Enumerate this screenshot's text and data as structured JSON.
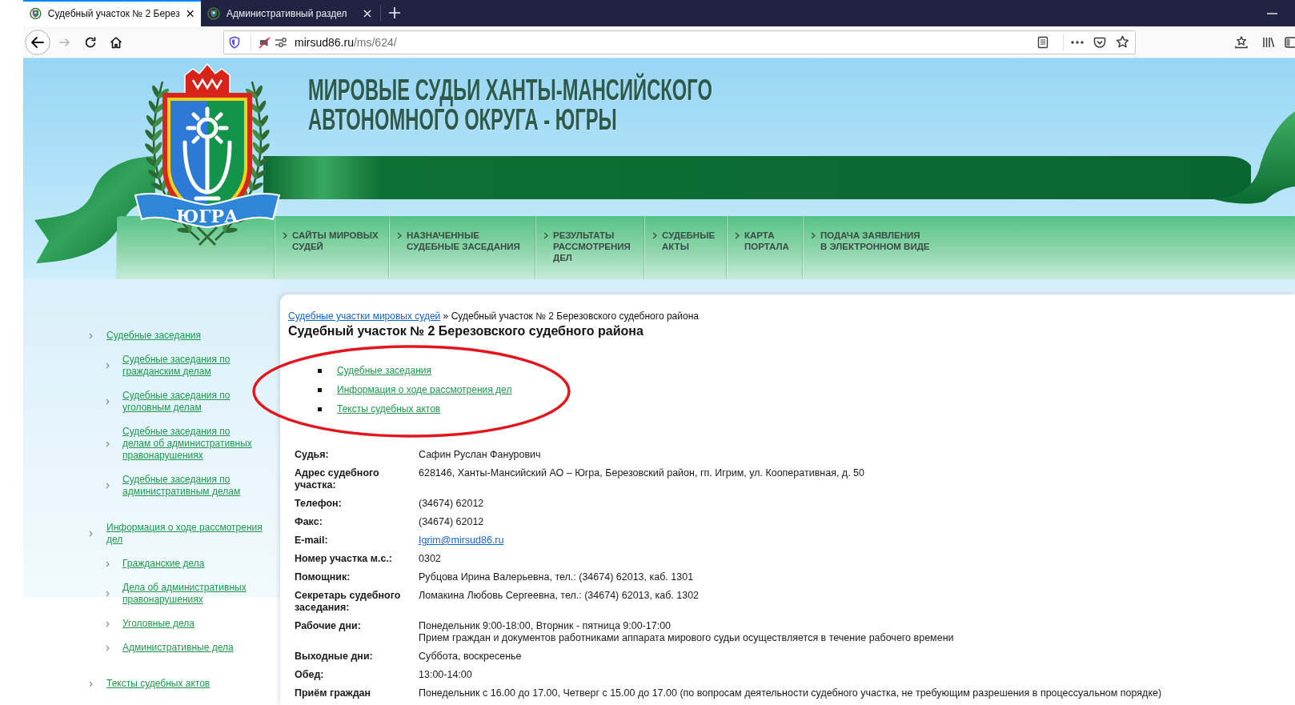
{
  "browser": {
    "tabs": [
      {
        "title": "Судебный участок № 2 Берез",
        "selected": true
      },
      {
        "title": "Административный раздел",
        "selected": false
      }
    ],
    "address": {
      "host": "mirsud86.ru",
      "path": "/ms/624/"
    }
  },
  "header": {
    "title_lines": [
      "МИРОВЫЕ СУДЬИ ХАНТЫ-МАНСИЙСКОГО",
      "АВТОНОМНОГО ОКРУГА - ЮГРЫ"
    ],
    "emblem_text": "ЮГРА"
  },
  "nav": [
    {
      "lines": [
        "САЙТЫ МИРОВЫХ",
        "СУДЕЙ"
      ]
    },
    {
      "lines": [
        "НАЗНАЧЕННЫЕ",
        "СУДЕБНЫЕ ЗАСЕДАНИЯ"
      ]
    },
    {
      "lines": [
        "РЕЗУЛЬТАТЫ",
        "РАССМОТРЕНИЯ",
        "ДЕЛ"
      ]
    },
    {
      "lines": [
        "СУДЕБНЫЕ",
        "АКТЫ"
      ]
    },
    {
      "lines": [
        "КАРТА",
        "ПОРТАЛА"
      ]
    },
    {
      "lines": [
        "ПОДАЧА ЗАЯВЛЕНИЯ",
        "В ЭЛЕКТРОННОМ ВИДЕ"
      ]
    }
  ],
  "sidebar": {
    "items": [
      {
        "label": "Судебные заседания",
        "children": [
          {
            "label": "Судебные заседания по гражданским делам"
          },
          {
            "label": "Судебные заседания по уголовным делам"
          },
          {
            "label": "Судебные заседания по делам об административных правонарушениях"
          },
          {
            "label": "Судебные заседания по административным делам"
          }
        ]
      },
      {
        "label": "Информация о ходе рассмотрения дел",
        "children": [
          {
            "label": "Гражданские дела"
          },
          {
            "label": "Дела об административных правонарушениях"
          },
          {
            "label": "Уголовные дела"
          },
          {
            "label": "Административные дела"
          }
        ]
      },
      {
        "label": "Тексты судебных актов"
      }
    ]
  },
  "content": {
    "breadcrumb": {
      "link": "Судебные участки мировых судей",
      "separator": "»",
      "current": "Судебный участок № 2 Березовского судебного района"
    },
    "heading": "Судебный участок № 2 Березовского судебного района",
    "links": [
      "Судебные заседания",
      "Информация о ходе рассмотрения дел",
      "Тексты судебных актов"
    ],
    "details": [
      {
        "label": "Судья:",
        "kind": "text",
        "lines": [
          "Сафин Руслан Фанурович"
        ]
      },
      {
        "label": "Адрес судебного участка:",
        "kind": "text",
        "lines": [
          "628146, Ханты-Мансийский АО – Югра, Березовский район, гп. Игрим, ул. Кооперативная, д. 50"
        ]
      },
      {
        "label": "Телефон:",
        "kind": "text",
        "lines": [
          "(34674) 62012"
        ]
      },
      {
        "label": "Факс:",
        "kind": "text",
        "lines": [
          "(34674) 62012"
        ]
      },
      {
        "label": "E-mail:",
        "kind": "email",
        "lines": [
          "Igrim@mirsud86.ru"
        ]
      },
      {
        "label": "Номер участка м.с.:",
        "kind": "text",
        "lines": [
          "0302"
        ]
      },
      {
        "label": "Помощник:",
        "kind": "text",
        "lines": [
          "Рубцова Ирина Валерьевна, тел.: (34674) 62013, каб. 1301"
        ]
      },
      {
        "label": "Секретарь судебного заседания:",
        "kind": "text",
        "lines": [
          "Ломакина Любовь Сергеевна, тел.: (34674) 62013, каб. 1302"
        ]
      },
      {
        "label": "Рабочие дни:",
        "kind": "text",
        "lines": [
          "Понедельник 9:00-18:00, Вторник - пятница 9:00-17:00",
          "Прием граждан и документов работниками аппарата мирового судьи осуществляется в течение рабочего времени"
        ]
      },
      {
        "label": "Выходные дни:",
        "kind": "text",
        "lines": [
          "Суббота, воскресенье"
        ]
      },
      {
        "label": "Обед:",
        "kind": "text",
        "lines": [
          "13:00-14:00"
        ]
      },
      {
        "label": "Приём граждан",
        "kind": "text",
        "lines": [
          "Понедельник с 16.00 до 17.00, Четверг с 15.00 до 17.00 (по вопросам деятельности судебного участка, не требующим разрешения в процессуальном порядке)"
        ]
      }
    ]
  }
}
